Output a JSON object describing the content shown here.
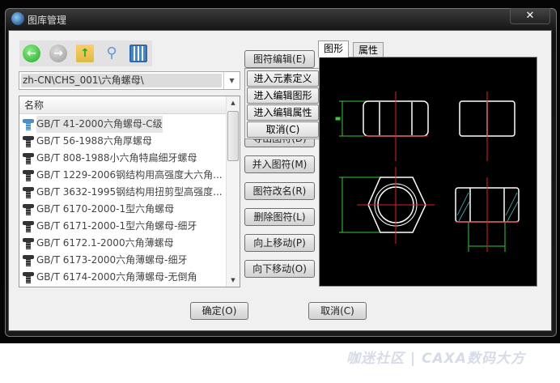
{
  "window": {
    "title": "图库管理",
    "close_label": "✕"
  },
  "toolbar": {
    "buttons": [
      {
        "icon": "back-icon"
      },
      {
        "icon": "forward-icon"
      },
      {
        "icon": "folder-up-icon"
      },
      {
        "icon": "search-icon"
      },
      {
        "icon": "view-icon"
      }
    ]
  },
  "path": {
    "value": "zh-CN\\CHS_001\\六角螺母\\"
  },
  "list": {
    "header": "名称",
    "items": [
      "GB/T 41-2000六角螺母-C级",
      "GB/T 56-1988六角厚螺母",
      "GB/T 808-1988小六角特扁细牙螺母",
      "GB/T 1229-2006钢结构用高强度大六角...",
      "GB/T 3632-1995钢结构用扭剪型高强度...",
      "GB/T 6170-2000-1型六角螺母",
      "GB/T 6171-2000-1型六角螺母-细牙",
      "GB/T 6172.1-2000六角薄螺母",
      "GB/T 6173-2000六角薄螺母-细牙",
      "GB/T 6174-2000六角薄螺母-无倒角"
    ]
  },
  "actions": {
    "edit": "图符编辑(E)",
    "export": "导出图符(D)",
    "merge": "并入图符(M)",
    "rename": "图符改名(R)",
    "delete": "删除图符(L)",
    "move_up": "向上移动(P)",
    "move_down": "向下移动(O)"
  },
  "edit_menu": [
    "进入元素定义(E)",
    "进入编辑图形(D)",
    "进入编辑属性(P)",
    "取消(C)"
  ],
  "tabs": [
    "图形",
    "属性"
  ],
  "footer": {
    "ok": "确定(O)",
    "cancel": "取消(C)"
  },
  "watermark": "咖迷社区 | CAXA数码大方",
  "colors": {
    "drawing_bg": "#000000",
    "outline": "#ffffff",
    "centerline": "#e02020",
    "dimension": "#33cc33",
    "hatch": "#40c0c0"
  }
}
